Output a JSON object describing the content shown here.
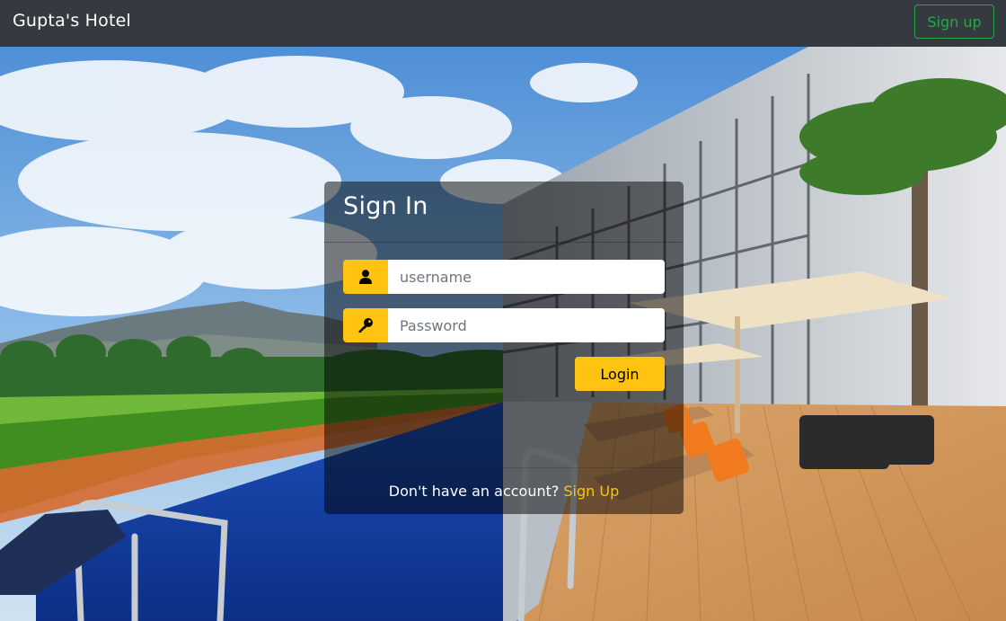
{
  "navbar": {
    "brand": "Gupta's Hotel",
    "signup_label": "Sign up",
    "signup_color": "#28a745"
  },
  "login_card": {
    "title": "Sign In",
    "username_placeholder": "username",
    "username_icon": "user-icon",
    "password_placeholder": "Password",
    "password_icon": "key-icon",
    "login_label": "Login",
    "footer_text": "Don't have an account?",
    "footer_link": "Sign Up",
    "accent_color": "#ffc312"
  }
}
